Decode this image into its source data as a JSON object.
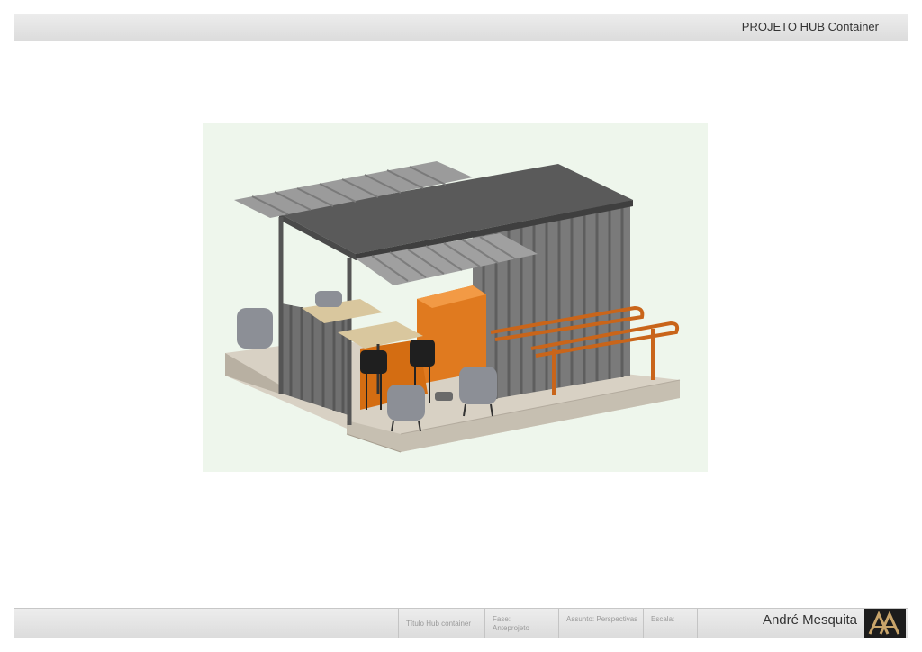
{
  "header": {
    "project_title": "PROJETO  HUB Container"
  },
  "footer": {
    "titulo": "Título Hub container",
    "fase_label": "Fase:",
    "fase_value": "Anteprojeto",
    "assunto": "Assunto: Perspectivas",
    "escala": "Escala:",
    "author": "André Mesquita"
  },
  "colors": {
    "accent": "#e07a1f",
    "container": "#6f6f6f",
    "deck": "#d2cbbf",
    "panel_bg": "#eef6ec"
  }
}
